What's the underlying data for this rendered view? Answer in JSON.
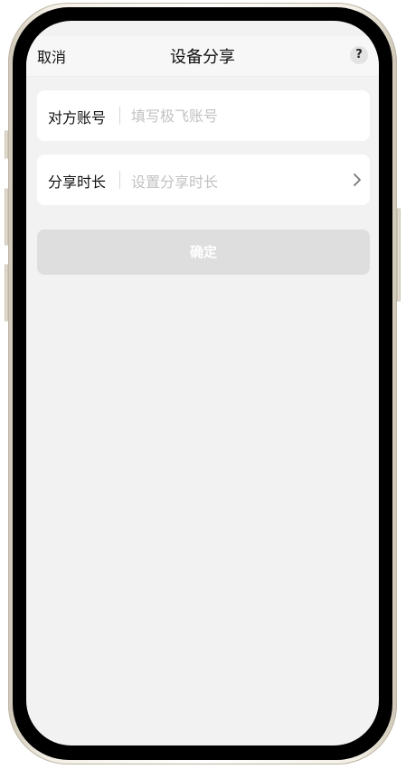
{
  "nav": {
    "cancel_label": "取消",
    "title": "设备分享",
    "help_label": "?"
  },
  "form": {
    "account": {
      "label": "对方账号",
      "placeholder": "填写极飞账号",
      "value": ""
    },
    "duration": {
      "label": "分享时长",
      "placeholder": "设置分享时长",
      "icon": "chevron-right-icon"
    }
  },
  "confirm_label": "确定",
  "colors": {
    "screen_bg": "#f2f2f2",
    "card_bg": "#ffffff",
    "button_disabled": "#dedede",
    "placeholder": "#c2c2c2"
  }
}
